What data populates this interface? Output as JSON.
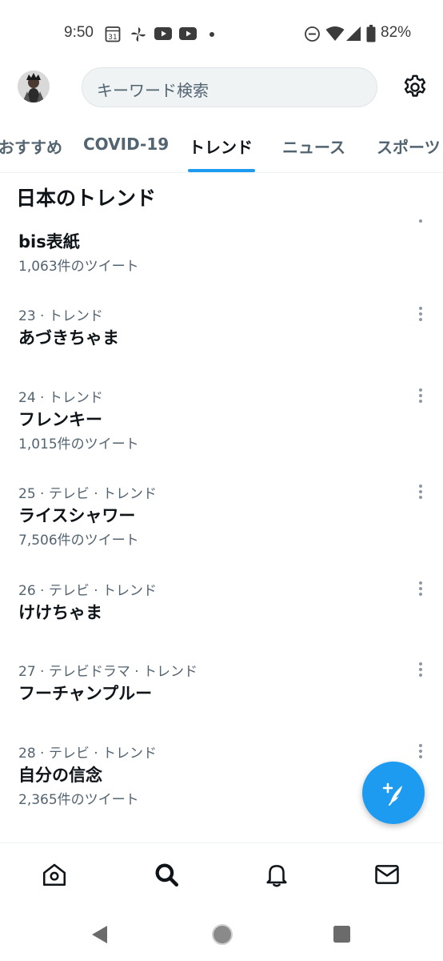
{
  "status_bar": {
    "time": "9:50",
    "calendar_day": "31",
    "battery": "82%",
    "icons": [
      "calendar-icon",
      "pinwheel-icon",
      "youtube-icon",
      "youtube-icon",
      "dot-icon",
      "dnd-icon",
      "wifi-icon",
      "signal-icon",
      "battery-icon"
    ]
  },
  "header": {
    "search_placeholder": "キーワード検索",
    "settings_icon": "gear-icon"
  },
  "tabs": [
    {
      "label": "おすすめ",
      "active": false
    },
    {
      "label": "COVID-19",
      "active": false
    },
    {
      "label": "トレンド",
      "active": true
    },
    {
      "label": "ニュース",
      "active": false
    },
    {
      "label": "スポーツ",
      "active": false
    }
  ],
  "section_title": "日本のトレンド",
  "trends": [
    {
      "meta": "",
      "name": "bis表紙",
      "count": "1,063件のツイート"
    },
    {
      "meta": "23 · トレンド",
      "name": "あづきちゃま",
      "count": ""
    },
    {
      "meta": "24 · トレンド",
      "name": "フレンキー",
      "count": "1,015件のツイート"
    },
    {
      "meta": "25 · テレビ · トレンド",
      "name": "ライスシャワー",
      "count": "7,506件のツイート"
    },
    {
      "meta": "26 · テレビ · トレンド",
      "name": "けけちゃま",
      "count": ""
    },
    {
      "meta": "27 · テレビドラマ · トレンド",
      "name": "フーチャンプルー",
      "count": ""
    },
    {
      "meta": "28 · テレビ · トレンド",
      "name": "自分の信念",
      "count": "2,365件のツイート"
    }
  ],
  "fab": {
    "icon": "compose-icon"
  },
  "bottom_nav": [
    {
      "name": "home",
      "icon": "home-icon",
      "active": false
    },
    {
      "name": "search",
      "icon": "search-icon",
      "active": true
    },
    {
      "name": "notifications",
      "icon": "bell-icon",
      "active": false
    },
    {
      "name": "messages",
      "icon": "mail-icon",
      "active": false
    }
  ],
  "colors": {
    "accent": "#1d9bf0",
    "text_primary": "#0f1419",
    "text_secondary": "#536471"
  }
}
